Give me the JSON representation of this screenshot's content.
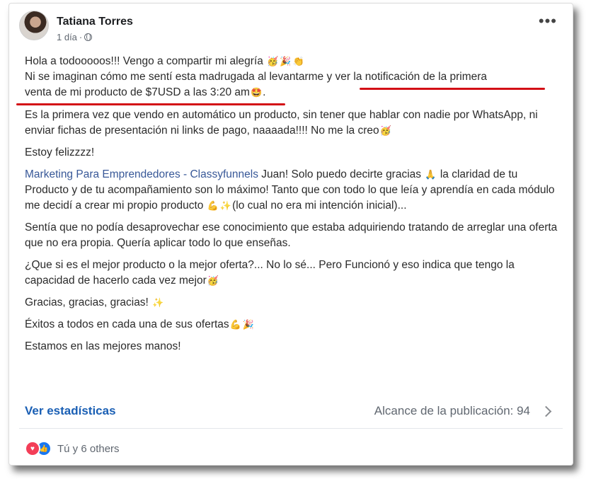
{
  "post": {
    "author": "Tatiana Torres",
    "time": "1 día",
    "more_icon": "more-horizontal-icon",
    "paragraphs": {
      "p1_line1": "Hola a todooooos!!! Vengo a compartir mi alegría",
      "p1_line2a": "Ni se imaginan cómo me sentí esta madrugada al levantarme y ",
      "p1_line2b": "ver la notificación de la primera",
      "p1_line3": "venta de mi producto de $7USD a las 3:20 am",
      "p2": "Es la primera vez que vendo en automático un producto, sin tener que hablar con nadie por WhatsApp, ni enviar fichas de presentación ni links de pago, naaaada!!!! No me la creo",
      "p3": "Estoy felizzzz!",
      "p4_link": "Marketing Para Emprendedores - Classyfunnels",
      "p4_a": " Juan! Solo puedo decirte gracias ",
      "p4_b": " la claridad de tu Producto y de tu acompañamiento son lo máximo! Tanto que con todo lo que leía y aprendía en cada módulo me decidí a crear mi propio producto ",
      "p4_c": "(lo cual no era mi intención inicial)...",
      "p5": "Sentía que no podía desaprovechar ese conocimiento que estaba adquiriendo tratando de arreglar una oferta que no era propia. Quería aplicar todo lo que enseñas.",
      "p6": "¿Que si es el mejor producto o la mejor oferta?... No lo sé... Pero Funcionó y eso indica que tengo la capacidad de hacerlo cada vez mejor",
      "p7": "Gracias, gracias, gracias!",
      "p8": "Éxitos a todos en cada una de sus ofertas",
      "p9": "Estamos en las mejores manos!"
    },
    "emoji": {
      "party_face": "🥳",
      "tada": "🎉",
      "clap": "👏",
      "star_eyes": "🤩",
      "pray": "🙏",
      "muscle": "💪",
      "sparkles": "✨"
    },
    "stats_link": "Ver estadísticas",
    "reach": "Alcance de la publicación: 94",
    "reactions_text": "Tú y 6 others",
    "colors": {
      "link": "#385898",
      "underline": "#d30f16",
      "love": "#f33e58",
      "like": "#1877f2"
    }
  }
}
